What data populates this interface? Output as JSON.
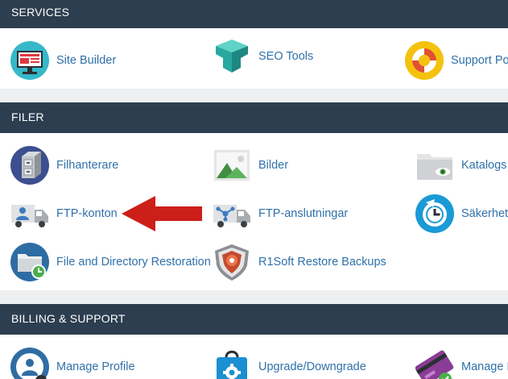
{
  "sections": [
    {
      "title": "SERVICES",
      "items": [
        {
          "label": "Site Builder",
          "icon": "monitor-icon"
        },
        {
          "label": "SEO Tools",
          "icon": "seo-cube-icon"
        },
        {
          "label": "Support Po",
          "icon": "lifebuoy-icon"
        }
      ]
    },
    {
      "title": "FILER",
      "items": [
        {
          "label": "Filhanterare",
          "icon": "file-cabinet-icon"
        },
        {
          "label": "Bilder",
          "icon": "image-landscape-icon"
        },
        {
          "label": "Katalogs",
          "icon": "folder-eye-icon"
        },
        {
          "label": "FTP-konton",
          "icon": "ftp-truck-user-icon"
        },
        {
          "label": "FTP-anslutningar",
          "icon": "ftp-truck-network-icon"
        },
        {
          "label": "Säkerhet",
          "icon": "backup-clock-icon"
        },
        {
          "label": "File and Directory Restoration",
          "icon": "folder-restore-icon"
        },
        {
          "label": "R1Soft Restore Backups",
          "icon": "r1soft-shield-icon"
        }
      ]
    },
    {
      "title": "BILLING & SUPPORT",
      "items": [
        {
          "label": "Manage Profile",
          "icon": "profile-user-icon"
        },
        {
          "label": "Upgrade/Downgrade",
          "icon": "shopping-bag-gear-icon"
        },
        {
          "label": "Manage I",
          "icon": "credit-card-check-icon"
        }
      ]
    }
  ],
  "annotation": {
    "icon": "red-arrow-left-icon",
    "color": "#cc1f1a"
  },
  "colors": {
    "header_bg": "#2c3e50",
    "header_text": "#ffffff",
    "link": "#3071a9",
    "page_bg": "#eef0f2",
    "panel_bg": "#ffffff"
  }
}
